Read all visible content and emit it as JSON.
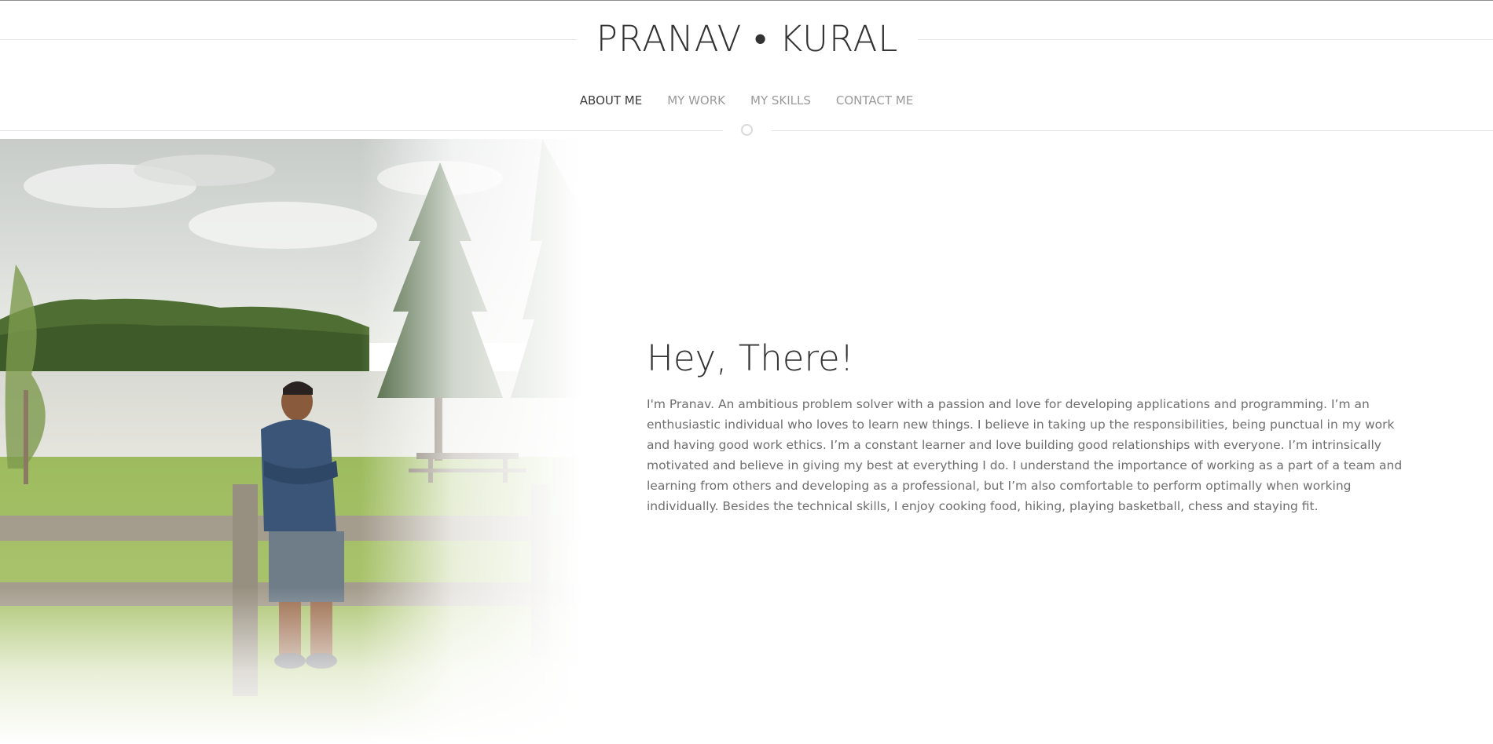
{
  "header": {
    "title": "PRANAV • KURAL"
  },
  "nav": {
    "items": [
      {
        "label": "ABOUT ME",
        "active": true
      },
      {
        "label": "MY WORK",
        "active": false
      },
      {
        "label": "MY SKILLS",
        "active": false
      },
      {
        "label": "CONTACT ME",
        "active": false
      }
    ]
  },
  "intro": {
    "heading": "Hey, There!",
    "body": "I'm Pranav. An ambitious problem solver with a passion and love for developing applications and programming. I’m an enthusiastic individual who loves to learn new things. I believe in taking up the responsibilities, being punctual in my work and having good work ethics. I’m a constant learner and love building good relationships with everyone. I’m intrinsically motivated and believe in giving my best at everything I do. I understand the importance of working as a part of a team and learning from others and developing as a professional, but I’m also comfortable to perform optimally when working individually. Besides the technical skills, I enjoy cooking food, hiking, playing basketball, chess and staying fit."
  },
  "colors": {
    "title_text": "#333333",
    "nav_active": "#3a3a3a",
    "nav_inactive": "#9a9a9a",
    "body_text": "#6e6e6e",
    "rule": "#e4e4e4"
  }
}
